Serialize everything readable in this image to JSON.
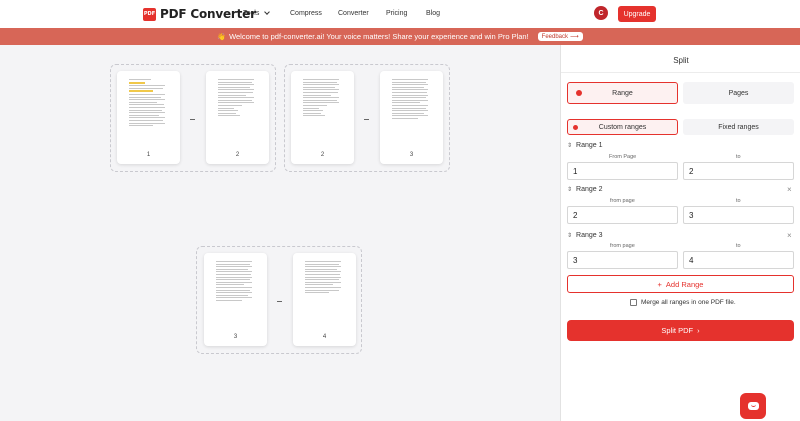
{
  "nav": {
    "logo_mark": "PDF",
    "logo_text": "PDF Converter",
    "items": [
      {
        "label": "Tools",
        "has_dropdown": true
      },
      {
        "label": "Compress"
      },
      {
        "label": "Converter"
      },
      {
        "label": "Pricing"
      },
      {
        "label": "Blog"
      }
    ],
    "avatar_initial": "C",
    "upgrade_label": "Upgrade"
  },
  "banner": {
    "message": "Welcome to pdf-converter.ai! Your voice matters! Share your experience and win Pro Plan!",
    "feedback_label": "Feedback",
    "feedback_arrow": "⟶"
  },
  "groups": [
    {
      "pages": [
        "1",
        "2"
      ]
    },
    {
      "pages": [
        "2",
        "3"
      ]
    },
    {
      "pages": [
        "3",
        "4"
      ]
    }
  ],
  "panel": {
    "title": "Split",
    "modes": [
      {
        "label": "Range",
        "active": true
      },
      {
        "label": "Pages",
        "active": false
      }
    ],
    "submodes": [
      {
        "label": "Custom ranges",
        "active": true
      },
      {
        "label": "Fixed ranges",
        "active": false
      }
    ],
    "ranges": [
      {
        "title": "Range 1",
        "from_label": "From Page",
        "to_label": "to",
        "from": "1",
        "to": "2",
        "removable": false
      },
      {
        "title": "Range 2",
        "from_label": "from page",
        "to_label": "to",
        "from": "2",
        "to": "3",
        "removable": true
      },
      {
        "title": "Range 3",
        "from_label": "from page",
        "to_label": "to",
        "from": "3",
        "to": "4",
        "removable": true
      }
    ],
    "add_range_label": "Add Range",
    "merge_label": "Merge all ranges in one PDF file.",
    "merge_checked": false,
    "split_label": "Split PDF",
    "split_arrow": "›"
  },
  "colors": {
    "accent": "#e5322d",
    "banner": "#d76657"
  }
}
